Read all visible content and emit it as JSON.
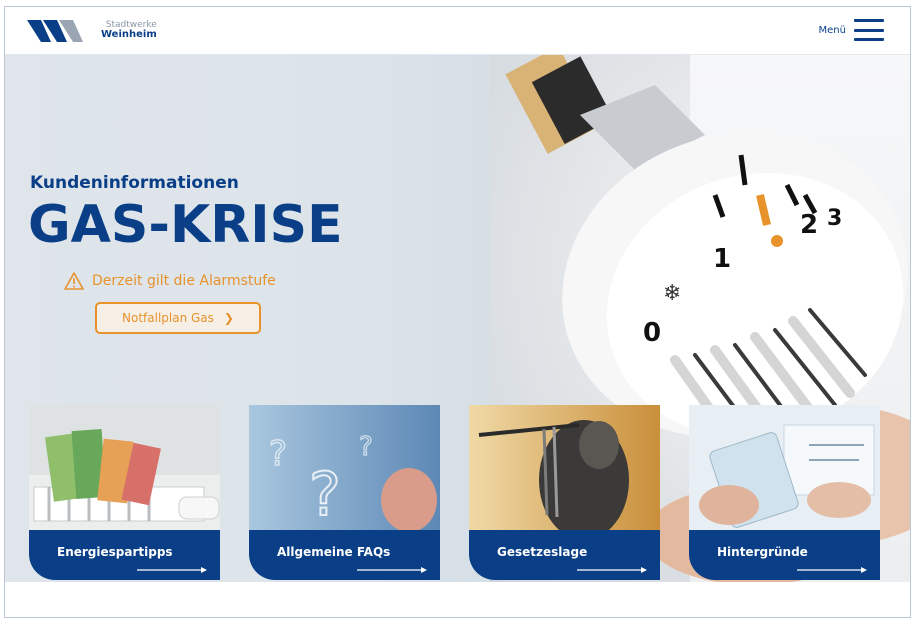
{
  "header": {
    "logo_small": "Stadtwerke",
    "logo_big": "Weinheim",
    "menu_label": "Menü",
    "menu_icon": "hamburger-icon"
  },
  "hero": {
    "subtitle": "Kundeninformationen",
    "title": "GAS-KRISE",
    "alert_text": "Derzeit gilt die Alarmstufe",
    "alert_icon": "warning-icon",
    "cta_label": "Notfallplan Gas",
    "cta_icon": "chevron-right-icon",
    "dial_marks": [
      "0",
      "1",
      "2",
      "3"
    ]
  },
  "tiles": [
    {
      "label": "Energiespartipps",
      "icon": "arrow-right-icon"
    },
    {
      "label": "Allgemeine FAQs",
      "icon": "arrow-right-icon"
    },
    {
      "label": "Gesetzeslage",
      "icon": "arrow-right-icon"
    },
    {
      "label": "Hintergründe",
      "icon": "arrow-right-icon"
    }
  ],
  "colors": {
    "brand_blue": "#0a3f88",
    "accent_orange": "#e8922c"
  }
}
